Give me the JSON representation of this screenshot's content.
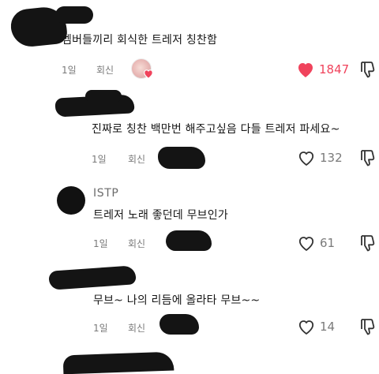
{
  "comments": [
    {
      "text": "멤버들끼리 회식한 트레저 칭찬함",
      "time": "1일",
      "reply_label": "회신",
      "likes": "1847",
      "liked": true,
      "liked_by_creator": true
    },
    {
      "text": "진짜로 칭찬 백만번 해주고싶음 다들 트레저 파세요~",
      "time": "1일",
      "reply_label": "회신",
      "likes": "132",
      "liked": false
    },
    {
      "username": "ISTP",
      "text": "트레저 노래 좋던데 무브인가",
      "time": "1일",
      "reply_label": "회신",
      "likes": "61",
      "liked": false
    },
    {
      "text": "무브~ 나의 리듬에 올라타 무브~~",
      "time": "1일",
      "reply_label": "회신",
      "likes": "14",
      "liked": false
    }
  ],
  "colors": {
    "like_active": "#f0435c",
    "meta_text": "#7a7a7a",
    "redaction": "#141414"
  },
  "icons": {
    "like": "heart-icon",
    "dislike": "thumbs-down-icon"
  }
}
